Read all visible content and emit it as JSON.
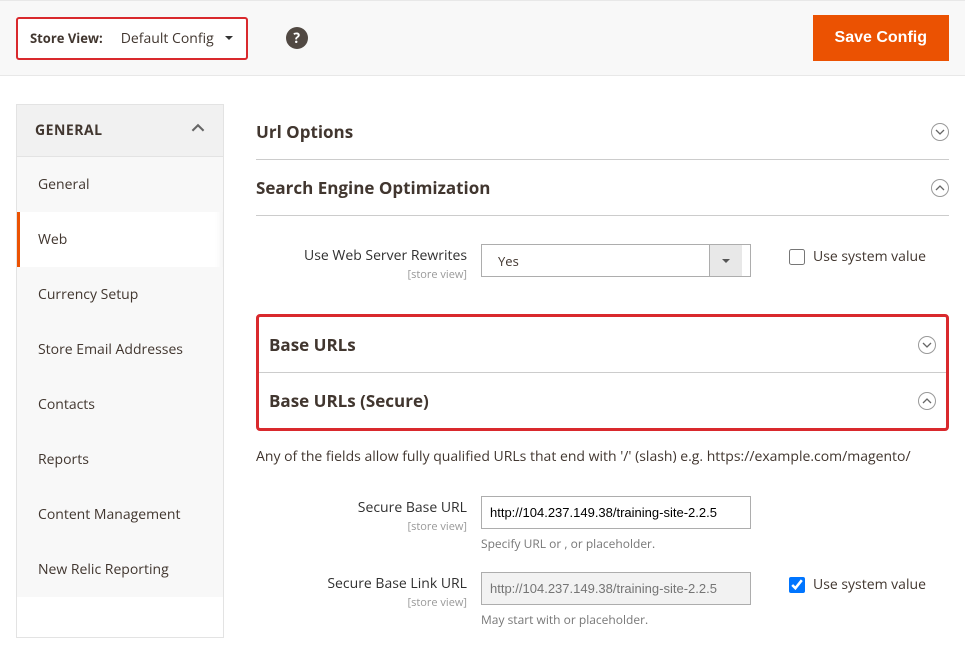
{
  "header": {
    "store_view_label": "Store View:",
    "store_view_value": "Default Config",
    "save_button": "Save Config"
  },
  "sidebar": {
    "group_title": "GENERAL",
    "items": [
      {
        "label": "General"
      },
      {
        "label": "Web"
      },
      {
        "label": "Currency Setup"
      },
      {
        "label": "Store Email Addresses"
      },
      {
        "label": "Contacts"
      },
      {
        "label": "Reports"
      },
      {
        "label": "Content Management"
      },
      {
        "label": "New Relic Reporting"
      }
    ]
  },
  "sections": {
    "url_options_title": "Url Options",
    "seo_title": "Search Engine Optimization",
    "base_urls_title": "Base URLs",
    "base_urls_secure_title": "Base URLs (Secure)"
  },
  "seo": {
    "rewrites_label": "Use Web Server Rewrites",
    "scope_label": "[store view]",
    "rewrites_value": "Yes",
    "use_system_label": "Use system value"
  },
  "secure": {
    "help_text": "Any of the fields allow fully qualified URLs that end with '/' (slash) e.g. https://example.com/magento/",
    "base_url_label": "Secure Base URL",
    "base_url_value": "http://104.237.149.38/training-site-2.2.5",
    "base_url_note": "Specify URL or , or placeholder.",
    "base_link_label": "Secure Base Link URL",
    "base_link_placeholder": "http://104.237.149.38/training-site-2.2.5",
    "base_link_note": "May start with or placeholder.",
    "scope_label": "[store view]",
    "use_system_label": "Use system value"
  }
}
